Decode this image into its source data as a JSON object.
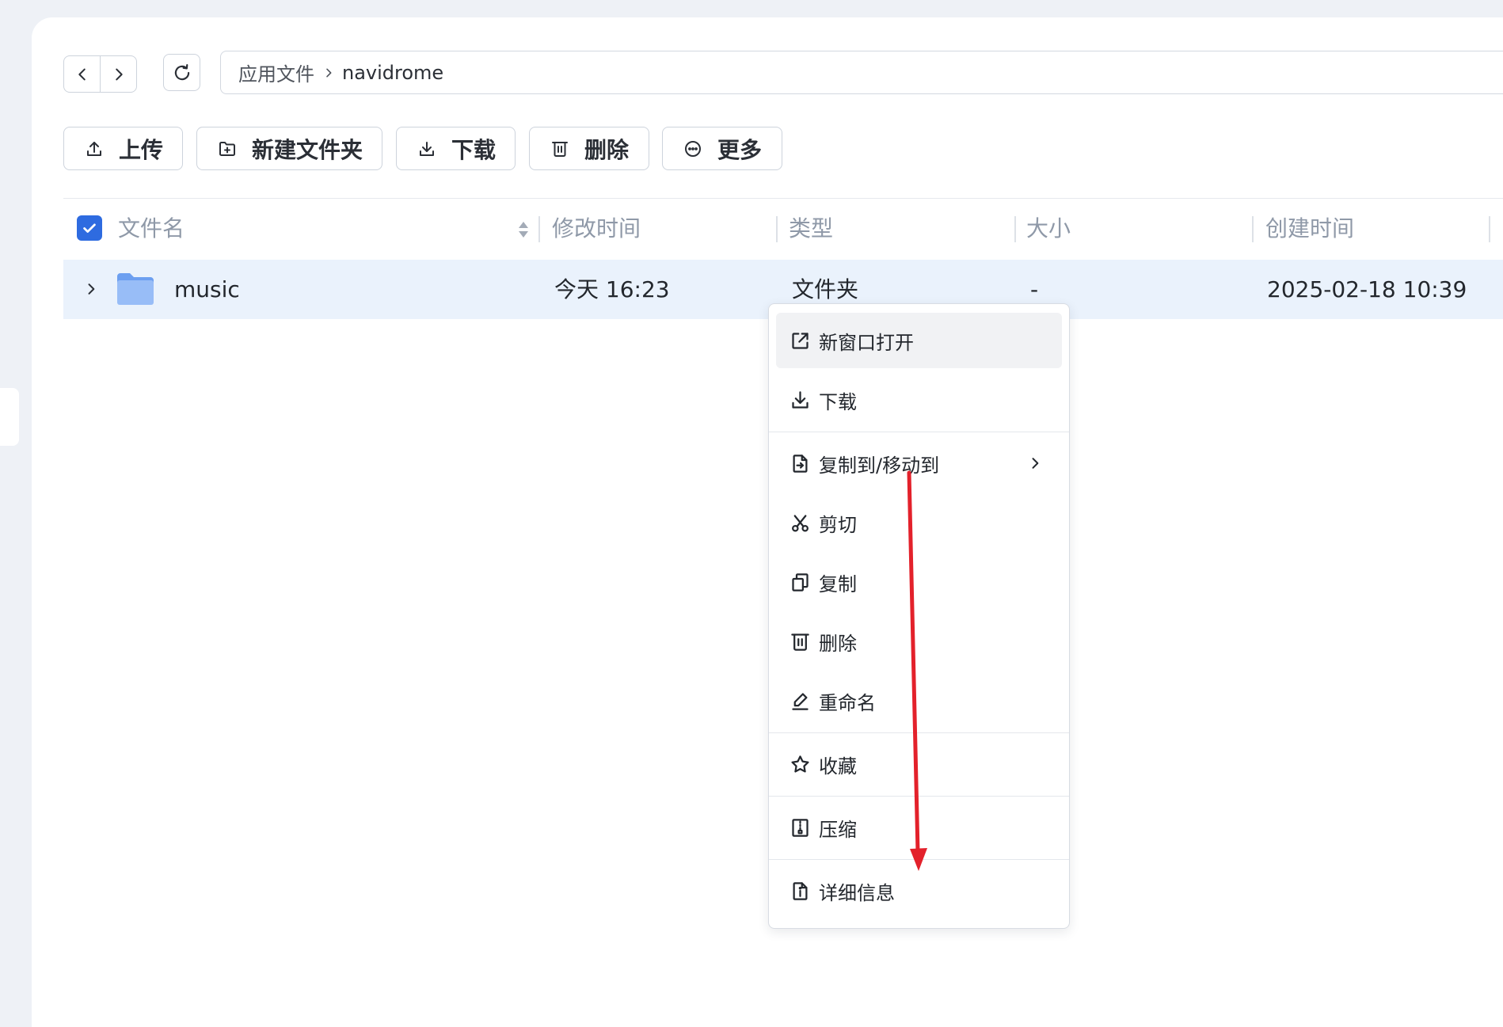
{
  "colors": {
    "page_bg": "#eef1f6",
    "accent": "#2e6be0",
    "selected_row": "#eaf2fc",
    "annotation": "#e3212b"
  },
  "nav": {
    "back_icon": "chevron-left-icon",
    "forward_icon": "chevron-right-icon",
    "refresh_icon": "refresh-icon"
  },
  "breadcrumb": {
    "items": [
      {
        "label": "应用文件"
      },
      {
        "label": "navidrome"
      }
    ],
    "separator_icon": "chevron-right-icon"
  },
  "toolbar": {
    "buttons": [
      {
        "label": "上传",
        "icon": "upload-icon"
      },
      {
        "label": "新建文件夹",
        "icon": "new-folder-icon"
      },
      {
        "label": "下载",
        "icon": "download-icon"
      },
      {
        "label": "删除",
        "icon": "delete-icon"
      },
      {
        "label": "更多",
        "icon": "more-icon"
      }
    ]
  },
  "table": {
    "select_all_checked": true,
    "columns": [
      {
        "label": "文件名",
        "sortable": true
      },
      {
        "label": "修改时间"
      },
      {
        "label": "类型"
      },
      {
        "label": "大小"
      },
      {
        "label": "创建时间"
      }
    ],
    "rows": [
      {
        "name": "music",
        "icon": "folder-icon",
        "modified": "今天 16:23",
        "type": "文件夹",
        "size": "-",
        "created": "2025-02-18 10:39",
        "selected": true
      }
    ]
  },
  "context_menu": {
    "groups": [
      [
        {
          "label": "新窗口打开",
          "icon": "new-window-icon",
          "highlighted": true
        },
        {
          "label": "下载",
          "icon": "download-icon"
        }
      ],
      [
        {
          "label": "复制到/移动到",
          "icon": "copy-move-icon",
          "submenu": true
        },
        {
          "label": "剪切",
          "icon": "cut-icon"
        },
        {
          "label": "复制",
          "icon": "copy-icon"
        },
        {
          "label": "删除",
          "icon": "delete-icon"
        },
        {
          "label": "重命名",
          "icon": "rename-icon"
        }
      ],
      [
        {
          "label": "收藏",
          "icon": "star-icon"
        }
      ],
      [
        {
          "label": "压缩",
          "icon": "compress-icon"
        }
      ],
      [
        {
          "label": "详细信息",
          "icon": "info-icon"
        }
      ]
    ]
  }
}
